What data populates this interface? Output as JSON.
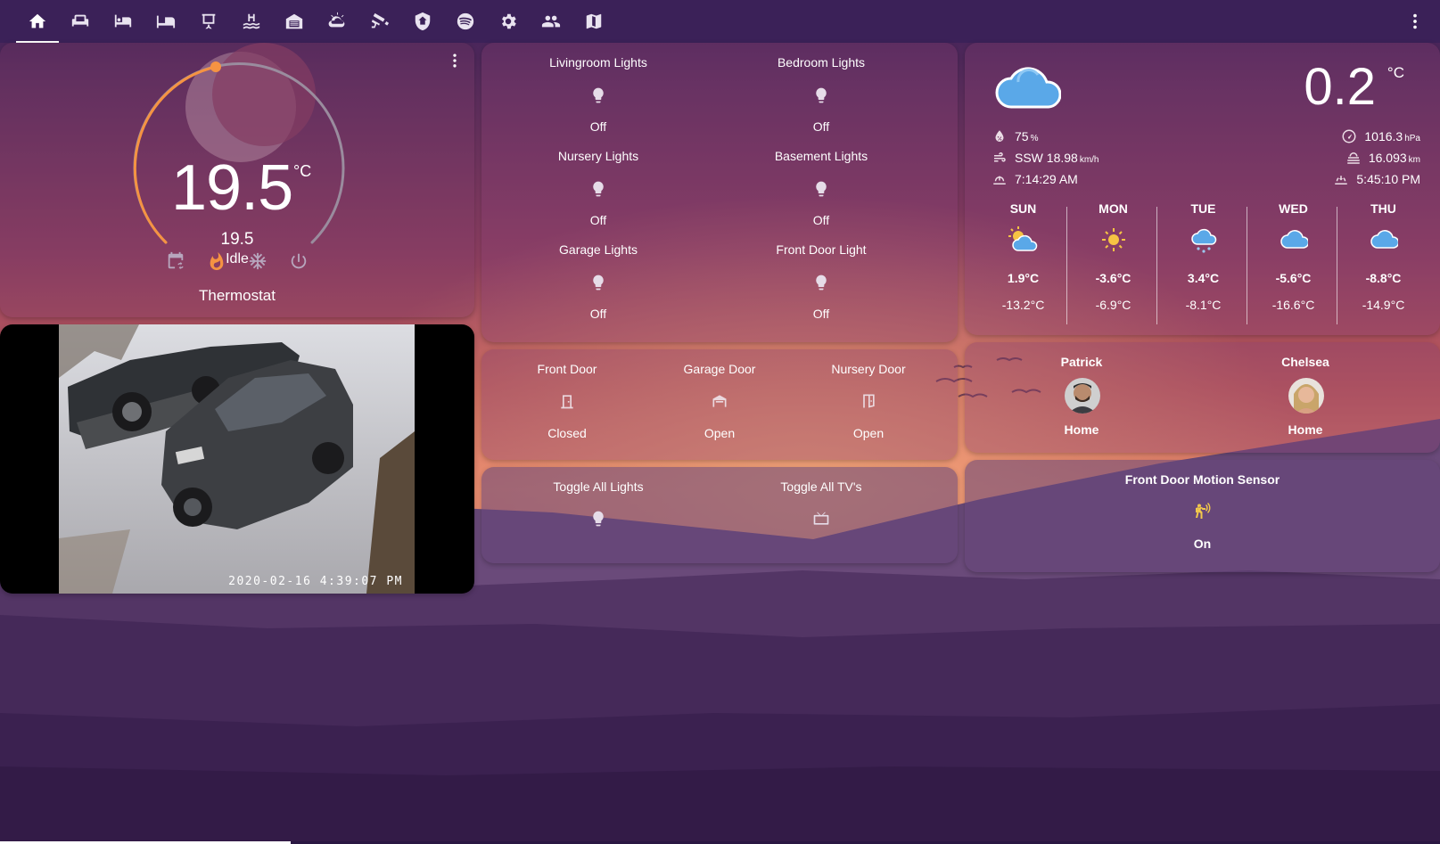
{
  "nav": {
    "tabs": [
      {
        "name": "home-icon",
        "active": true
      },
      {
        "name": "sofa-icon",
        "active": false
      },
      {
        "name": "bed-icon",
        "active": false
      },
      {
        "name": "bed-empty-icon",
        "active": false
      },
      {
        "name": "projector-screen-icon",
        "active": false
      },
      {
        "name": "pool-icon",
        "active": false
      },
      {
        "name": "garage-icon",
        "active": false
      },
      {
        "name": "weather-partly-cloudy-icon",
        "active": false
      },
      {
        "name": "cctv-icon",
        "active": false
      },
      {
        "name": "shield-home-icon",
        "active": false
      },
      {
        "name": "spotify-icon",
        "active": false
      },
      {
        "name": "gear-icon",
        "active": false
      },
      {
        "name": "account-group-icon",
        "active": false
      },
      {
        "name": "map-icon",
        "active": false
      }
    ]
  },
  "thermostat": {
    "current_temp": "19.5",
    "unit": "°C",
    "target_temp": "19.5",
    "action": "Idle",
    "name": "Thermostat",
    "modes": [
      "calendar-sync-icon",
      "fire-icon",
      "snowflake-icon",
      "power-icon"
    ],
    "active_mode": "fire-icon",
    "accent_color": "#f59342"
  },
  "camera": {
    "timestamp": "2020-02-16 4:39:07 PM"
  },
  "lights": [
    {
      "label": "Livingroom Lights",
      "state": "Off"
    },
    {
      "label": "Bedroom Lights",
      "state": "Off"
    },
    {
      "label": "Nursery Lights",
      "state": "Off"
    },
    {
      "label": "Basement Lights",
      "state": "Off"
    },
    {
      "label": "Garage Lights",
      "state": "Off"
    },
    {
      "label": "Front Door Light",
      "state": "Off"
    }
  ],
  "doors": [
    {
      "label": "Front Door",
      "state": "Closed",
      "icon": "door-closed-icon"
    },
    {
      "label": "Garage Door",
      "state": "Open",
      "icon": "garage-open-icon"
    },
    {
      "label": "Nursery Door",
      "state": "Open",
      "icon": "door-open-icon"
    }
  ],
  "toggles": [
    {
      "label": "Toggle All Lights",
      "icon": "lightbulb-icon"
    },
    {
      "label": "Toggle All TV's",
      "icon": "television-icon"
    }
  ],
  "weather": {
    "temp": "0.2",
    "unit": "°C",
    "condition_icon": "cloudy-icon",
    "humidity": "75",
    "humidity_unit": "%",
    "wind": "SSW 18.98",
    "wind_unit": "km/h",
    "sunrise": "7:14:29 AM",
    "pressure": "1016.3",
    "pressure_unit": "hPa",
    "visibility": "16.093",
    "visibility_unit": "km",
    "sunset": "5:45:10 PM",
    "forecast": [
      {
        "day": "SUN",
        "high": "1.9°C",
        "low": "-13.2°C",
        "icon": "partly-cloudy-icon"
      },
      {
        "day": "MON",
        "high": "-3.6°C",
        "low": "-6.9°C",
        "icon": "sunny-icon"
      },
      {
        "day": "TUE",
        "high": "3.4°C",
        "low": "-8.1°C",
        "icon": "snowy-icon"
      },
      {
        "day": "WED",
        "high": "-5.6°C",
        "low": "-16.6°C",
        "icon": "cloudy-icon"
      },
      {
        "day": "THU",
        "high": "-8.8°C",
        "low": "-14.9°C",
        "icon": "cloudy-icon"
      }
    ]
  },
  "people": [
    {
      "name": "Patrick",
      "state": "Home"
    },
    {
      "name": "Chelsea",
      "state": "Home"
    }
  ],
  "motion": {
    "label": "Front Door Motion Sensor",
    "state": "On",
    "icon": "motion-sensor-icon"
  }
}
